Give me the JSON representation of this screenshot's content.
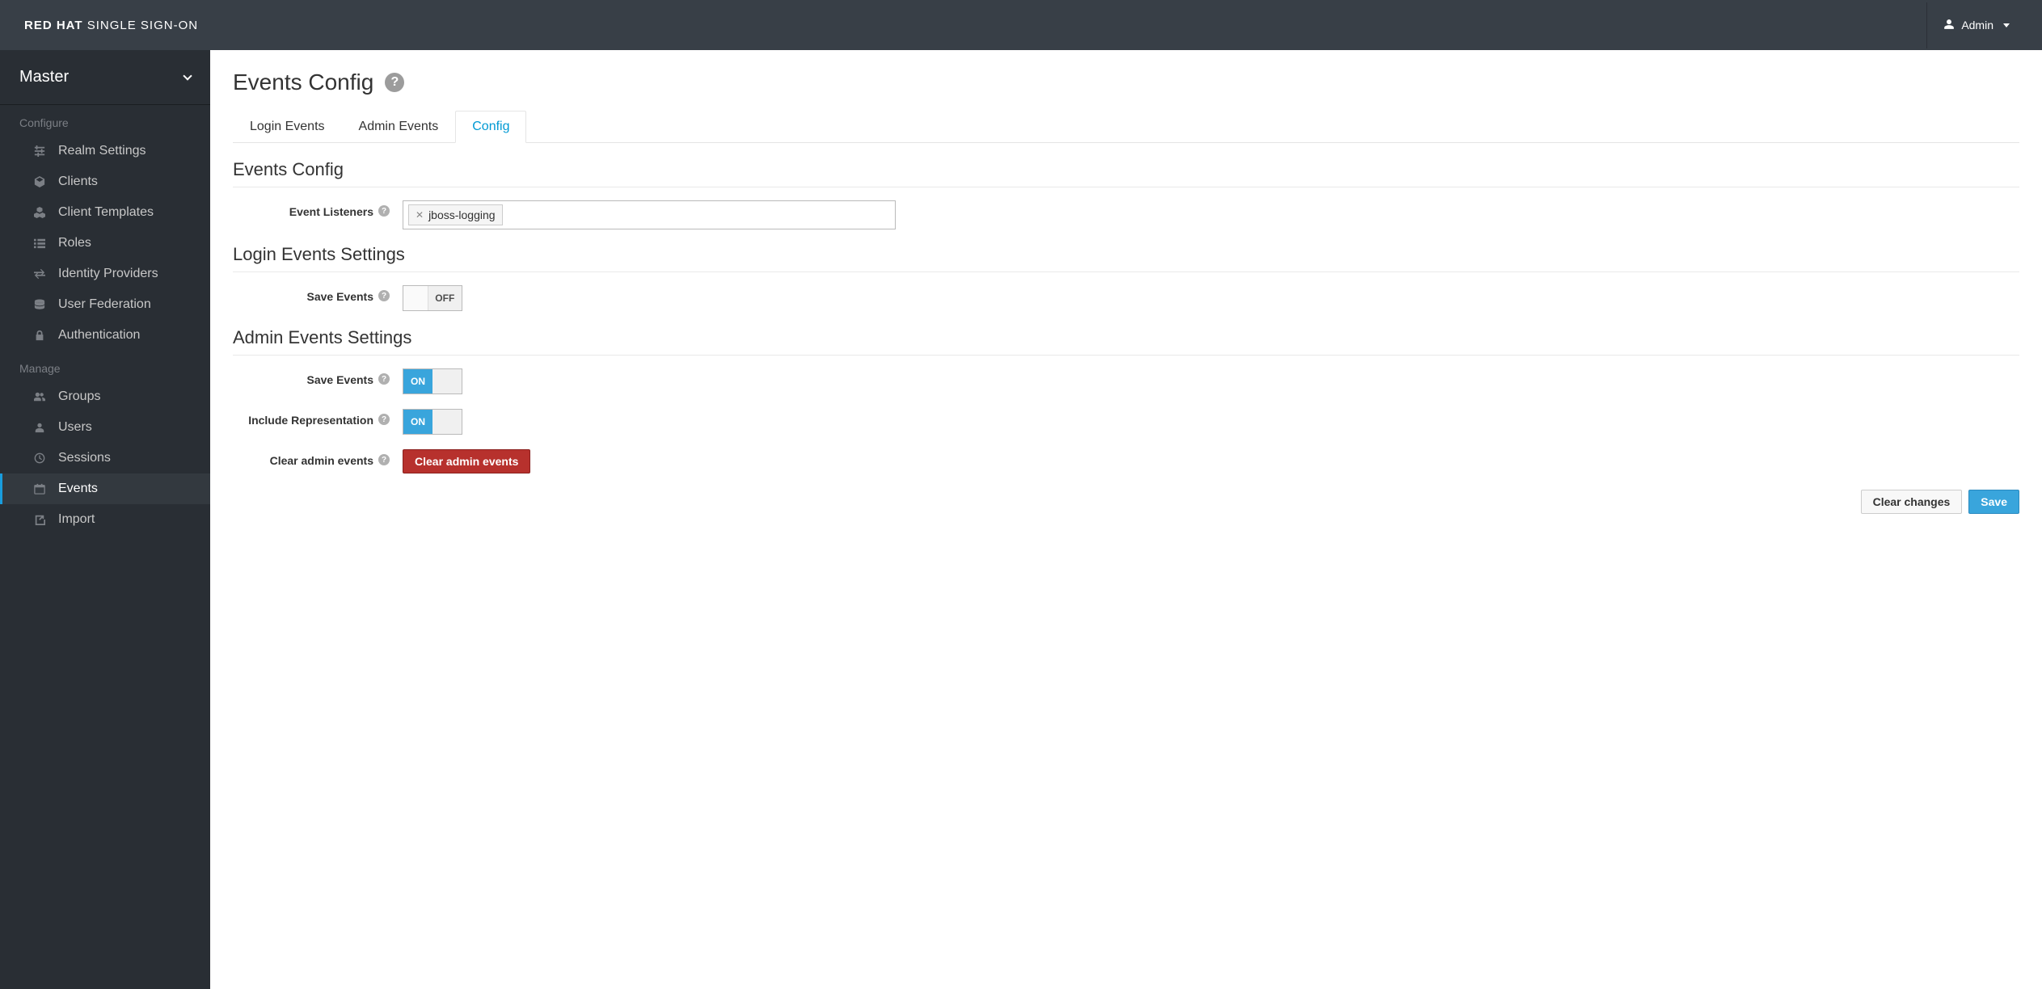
{
  "brand": {
    "bold": "RED HAT",
    "rest": "SINGLE SIGN-ON"
  },
  "user": {
    "name": "Admin"
  },
  "realm_selector": {
    "current": "Master"
  },
  "sidebar": {
    "sections": [
      {
        "header": "Configure",
        "items": [
          {
            "label": "Realm Settings",
            "icon": "sliders"
          },
          {
            "label": "Clients",
            "icon": "cube"
          },
          {
            "label": "Client Templates",
            "icon": "cubes"
          },
          {
            "label": "Roles",
            "icon": "list"
          },
          {
            "label": "Identity Providers",
            "icon": "exchange"
          },
          {
            "label": "User Federation",
            "icon": "database"
          },
          {
            "label": "Authentication",
            "icon": "lock"
          }
        ]
      },
      {
        "header": "Manage",
        "items": [
          {
            "label": "Groups",
            "icon": "users"
          },
          {
            "label": "Users",
            "icon": "user"
          },
          {
            "label": "Sessions",
            "icon": "clock"
          },
          {
            "label": "Events",
            "icon": "calendar",
            "active": true
          },
          {
            "label": "Import",
            "icon": "import"
          }
        ]
      }
    ]
  },
  "page": {
    "title": "Events Config",
    "tabs": [
      {
        "label": "Login Events"
      },
      {
        "label": "Admin Events"
      },
      {
        "label": "Config",
        "active": true
      }
    ]
  },
  "sections": {
    "events_config": {
      "title": "Events Config",
      "event_listeners": {
        "label": "Event Listeners",
        "values": [
          "jboss-logging"
        ]
      }
    },
    "login_events": {
      "title": "Login Events Settings",
      "save_events": {
        "label": "Save Events",
        "value": "OFF"
      }
    },
    "admin_events": {
      "title": "Admin Events Settings",
      "save_events": {
        "label": "Save Events",
        "value": "ON"
      },
      "include_rep": {
        "label": "Include Representation",
        "value": "ON"
      },
      "clear": {
        "label": "Clear admin events",
        "button": "Clear admin events"
      }
    }
  },
  "actions": {
    "clear_changes": "Clear changes",
    "save": "Save"
  },
  "toggle_text": {
    "on": "ON",
    "off": "OFF"
  }
}
